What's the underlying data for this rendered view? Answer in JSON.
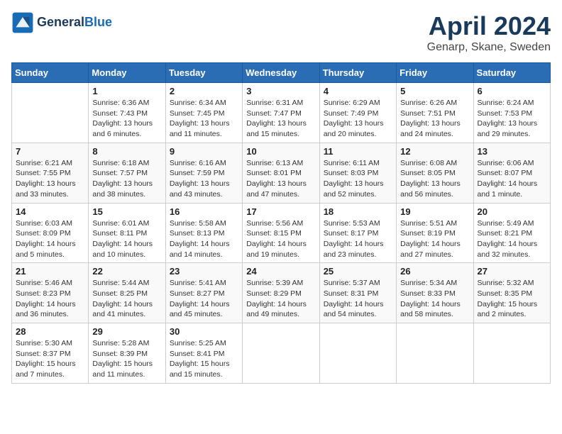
{
  "header": {
    "logo_line1": "General",
    "logo_line2": "Blue",
    "title": "April 2024",
    "subtitle": "Genarp, Skane, Sweden"
  },
  "columns": [
    "Sunday",
    "Monday",
    "Tuesday",
    "Wednesday",
    "Thursday",
    "Friday",
    "Saturday"
  ],
  "weeks": [
    [
      {
        "num": "",
        "info": ""
      },
      {
        "num": "1",
        "info": "Sunrise: 6:36 AM\nSunset: 7:43 PM\nDaylight: 13 hours\nand 6 minutes."
      },
      {
        "num": "2",
        "info": "Sunrise: 6:34 AM\nSunset: 7:45 PM\nDaylight: 13 hours\nand 11 minutes."
      },
      {
        "num": "3",
        "info": "Sunrise: 6:31 AM\nSunset: 7:47 PM\nDaylight: 13 hours\nand 15 minutes."
      },
      {
        "num": "4",
        "info": "Sunrise: 6:29 AM\nSunset: 7:49 PM\nDaylight: 13 hours\nand 20 minutes."
      },
      {
        "num": "5",
        "info": "Sunrise: 6:26 AM\nSunset: 7:51 PM\nDaylight: 13 hours\nand 24 minutes."
      },
      {
        "num": "6",
        "info": "Sunrise: 6:24 AM\nSunset: 7:53 PM\nDaylight: 13 hours\nand 29 minutes."
      }
    ],
    [
      {
        "num": "7",
        "info": "Sunrise: 6:21 AM\nSunset: 7:55 PM\nDaylight: 13 hours\nand 33 minutes."
      },
      {
        "num": "8",
        "info": "Sunrise: 6:18 AM\nSunset: 7:57 PM\nDaylight: 13 hours\nand 38 minutes."
      },
      {
        "num": "9",
        "info": "Sunrise: 6:16 AM\nSunset: 7:59 PM\nDaylight: 13 hours\nand 43 minutes."
      },
      {
        "num": "10",
        "info": "Sunrise: 6:13 AM\nSunset: 8:01 PM\nDaylight: 13 hours\nand 47 minutes."
      },
      {
        "num": "11",
        "info": "Sunrise: 6:11 AM\nSunset: 8:03 PM\nDaylight: 13 hours\nand 52 minutes."
      },
      {
        "num": "12",
        "info": "Sunrise: 6:08 AM\nSunset: 8:05 PM\nDaylight: 13 hours\nand 56 minutes."
      },
      {
        "num": "13",
        "info": "Sunrise: 6:06 AM\nSunset: 8:07 PM\nDaylight: 14 hours\nand 1 minute."
      }
    ],
    [
      {
        "num": "14",
        "info": "Sunrise: 6:03 AM\nSunset: 8:09 PM\nDaylight: 14 hours\nand 5 minutes."
      },
      {
        "num": "15",
        "info": "Sunrise: 6:01 AM\nSunset: 8:11 PM\nDaylight: 14 hours\nand 10 minutes."
      },
      {
        "num": "16",
        "info": "Sunrise: 5:58 AM\nSunset: 8:13 PM\nDaylight: 14 hours\nand 14 minutes."
      },
      {
        "num": "17",
        "info": "Sunrise: 5:56 AM\nSunset: 8:15 PM\nDaylight: 14 hours\nand 19 minutes."
      },
      {
        "num": "18",
        "info": "Sunrise: 5:53 AM\nSunset: 8:17 PM\nDaylight: 14 hours\nand 23 minutes."
      },
      {
        "num": "19",
        "info": "Sunrise: 5:51 AM\nSunset: 8:19 PM\nDaylight: 14 hours\nand 27 minutes."
      },
      {
        "num": "20",
        "info": "Sunrise: 5:49 AM\nSunset: 8:21 PM\nDaylight: 14 hours\nand 32 minutes."
      }
    ],
    [
      {
        "num": "21",
        "info": "Sunrise: 5:46 AM\nSunset: 8:23 PM\nDaylight: 14 hours\nand 36 minutes."
      },
      {
        "num": "22",
        "info": "Sunrise: 5:44 AM\nSunset: 8:25 PM\nDaylight: 14 hours\nand 41 minutes."
      },
      {
        "num": "23",
        "info": "Sunrise: 5:41 AM\nSunset: 8:27 PM\nDaylight: 14 hours\nand 45 minutes."
      },
      {
        "num": "24",
        "info": "Sunrise: 5:39 AM\nSunset: 8:29 PM\nDaylight: 14 hours\nand 49 minutes."
      },
      {
        "num": "25",
        "info": "Sunrise: 5:37 AM\nSunset: 8:31 PM\nDaylight: 14 hours\nand 54 minutes."
      },
      {
        "num": "26",
        "info": "Sunrise: 5:34 AM\nSunset: 8:33 PM\nDaylight: 14 hours\nand 58 minutes."
      },
      {
        "num": "27",
        "info": "Sunrise: 5:32 AM\nSunset: 8:35 PM\nDaylight: 15 hours\nand 2 minutes."
      }
    ],
    [
      {
        "num": "28",
        "info": "Sunrise: 5:30 AM\nSunset: 8:37 PM\nDaylight: 15 hours\nand 7 minutes."
      },
      {
        "num": "29",
        "info": "Sunrise: 5:28 AM\nSunset: 8:39 PM\nDaylight: 15 hours\nand 11 minutes."
      },
      {
        "num": "30",
        "info": "Sunrise: 5:25 AM\nSunset: 8:41 PM\nDaylight: 15 hours\nand 15 minutes."
      },
      {
        "num": "",
        "info": ""
      },
      {
        "num": "",
        "info": ""
      },
      {
        "num": "",
        "info": ""
      },
      {
        "num": "",
        "info": ""
      }
    ]
  ]
}
